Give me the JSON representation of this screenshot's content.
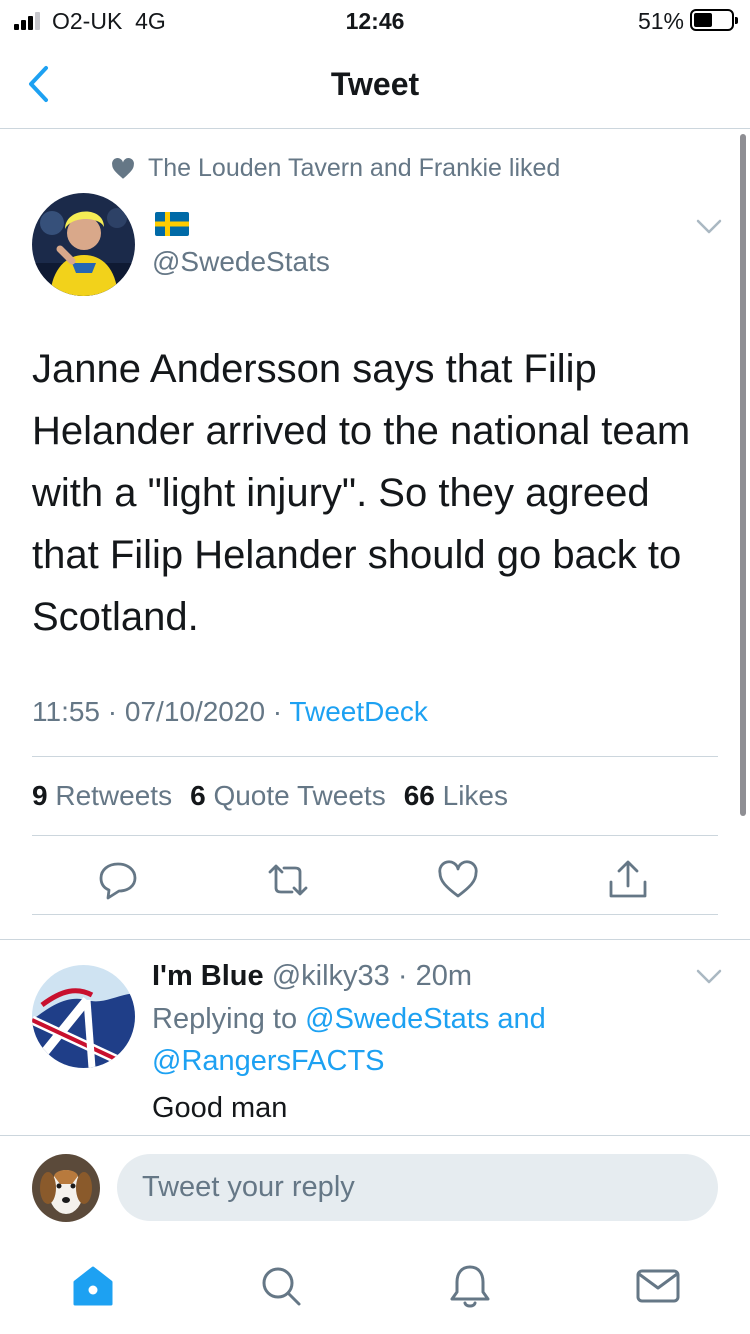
{
  "status_bar": {
    "carrier": "O2-UK",
    "network": "4G",
    "time": "12:46",
    "battery": "51%",
    "battery_level": 0.51
  },
  "nav": {
    "title": "Tweet",
    "back_icon": "chevron-left-icon"
  },
  "tweet": {
    "social_context": "The Louden Tavern and Frankie liked",
    "display_name_flag": "🇸🇪",
    "handle": "@SwedeStats",
    "text": "Janne Andersson says that Filip Helander arrived to the national team with a \"light injury\". So they agreed that Filip Helander should go back to Scotland.",
    "time": "11:55",
    "date": "07/10/2020",
    "source": "TweetDeck",
    "retweets_count": "9",
    "retweets_label": "Retweets",
    "quotes_count": "6",
    "quotes_label": "Quote Tweets",
    "likes_count": "66",
    "likes_label": "Likes",
    "actions": [
      "reply-icon",
      "retweet-icon",
      "like-icon",
      "share-icon"
    ]
  },
  "reply": {
    "name": "I'm Blue",
    "handle": "@kilky33",
    "age": "20m",
    "replying_prefix": "Replying to",
    "replying_users": "@SwedeStats and @RangersFACTS",
    "text": "Good man"
  },
  "composer": {
    "placeholder": "Tweet your reply"
  },
  "tabbar": {
    "tabs": [
      "home-icon",
      "search-icon",
      "notifications-icon",
      "messages-icon"
    ],
    "active": "home-icon"
  },
  "colors": {
    "accent": "#1da1f2",
    "secondary_text": "#657786",
    "divider": "#ccd6dd"
  }
}
